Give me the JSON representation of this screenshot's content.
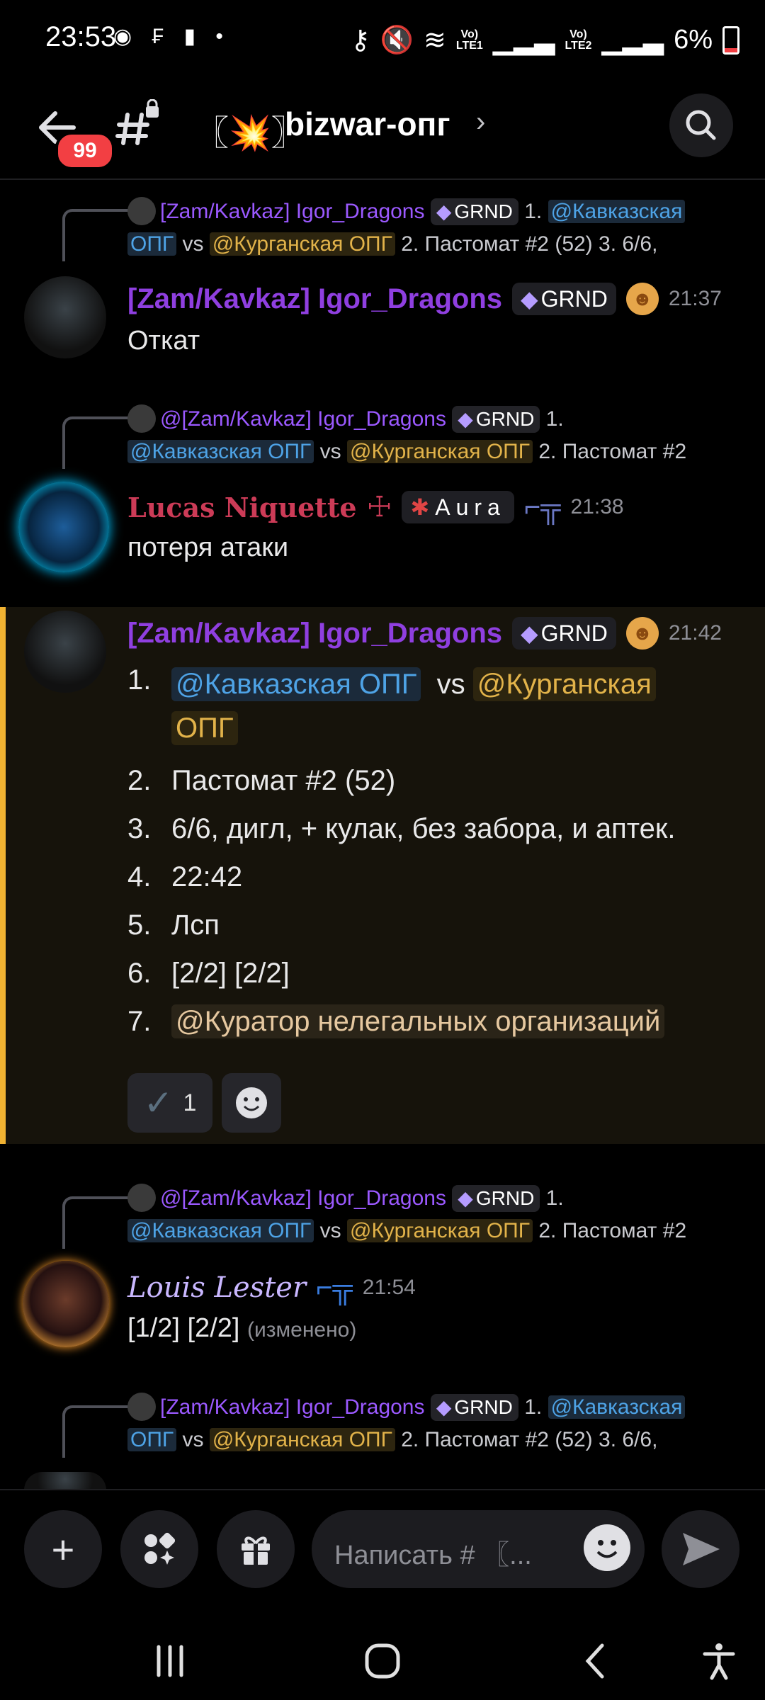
{
  "status": {
    "time": "23:53",
    "left_icons": "◉ ₣ ▮ •",
    "lte1": "Vo)\nLTE1",
    "lte2": "Vo)\nLTE2",
    "battery": "6%"
  },
  "header": {
    "unread_badge": "99",
    "channel_emoji": "〖💥〗",
    "channel_name": "bizwar-опг",
    "chevron": "›"
  },
  "messages": [
    {
      "reply": {
        "author": "[Zam/Kavkaz] Igor_Dragons",
        "tag": "GRND",
        "num1": "1.",
        "mention1": "@Кавказская",
        "mention1b": "ОПГ",
        "vs": "vs",
        "mention2": "@Курганская ОПГ",
        "rest": "2.  Пастомат #2 (52)   3.  6/6,"
      },
      "author": "[Zam/Kavkaz] Igor_Dragons",
      "tag": "GRND",
      "time": "21:37",
      "text": "Откат"
    },
    {
      "reply": {
        "author": "@[Zam/Kavkaz] Igor_Dragons",
        "tag": "GRND",
        "num1": "1.",
        "mention1": "@Кавказская ОПГ",
        "vs": "vs",
        "mention2": "@Курганская ОПГ",
        "rest": "2.  Пастомат #2"
      },
      "author": "Lucas Niquette",
      "author_suffix": "☩",
      "tag": "Aura",
      "time": "21:38",
      "text": "потеря атаки"
    },
    {
      "author": "[Zam/Kavkaz] Igor_Dragons",
      "tag": "GRND",
      "time": "21:42",
      "list": [
        {
          "n": "1.",
          "m1": "@Кавказская ОПГ",
          "vs": "vs",
          "m2a": "@Курганская",
          "m2b": "ОПГ"
        },
        {
          "n": "2.",
          "t": "Пастомат #2 (52)"
        },
        {
          "n": "3.",
          "t": "6/6, дигл, + кулак, без забора, и аптек."
        },
        {
          "n": "4.",
          "t": "22:42"
        },
        {
          "n": "5.",
          "t": "Лсп"
        },
        {
          "n": "6.",
          "t": "[2/2] [2/2]"
        },
        {
          "n": "7.",
          "m": "@Куратор нелегальных организаций"
        }
      ],
      "reaction_count": "1"
    },
    {
      "reply": {
        "author": "@[Zam/Kavkaz] Igor_Dragons",
        "tag": "GRND",
        "num1": "1.",
        "mention1": "@Кавказская ОПГ",
        "vs": "vs",
        "mention2": "@Курганская ОПГ",
        "rest": "2.  Пастомат #2"
      },
      "author": "Louis Lester",
      "time": "21:54",
      "text": "[1/2] [2/2]",
      "edited": "(изменено)"
    },
    {
      "reply": {
        "author": "[Zam/Kavkaz] Igor_Dragons",
        "tag": "GRND",
        "num1": "1.",
        "mention1": "@Кавказская",
        "mention1b": "ОПГ",
        "vs": "vs",
        "mention2": "@Курганская ОПГ",
        "rest": "2.  Пастомат #2 (52)   3.  6/6,"
      }
    }
  ],
  "composer": {
    "placeholder": "Написать # 〖...",
    "plus": "+",
    "apps": "✦",
    "gift": "🎁"
  },
  "colors": {
    "accent_highlight": "#f0b232",
    "mention_blue": "#4ea3e6",
    "mention_yellow": "#e2b34a",
    "author_purple": "#8f3fe0"
  }
}
